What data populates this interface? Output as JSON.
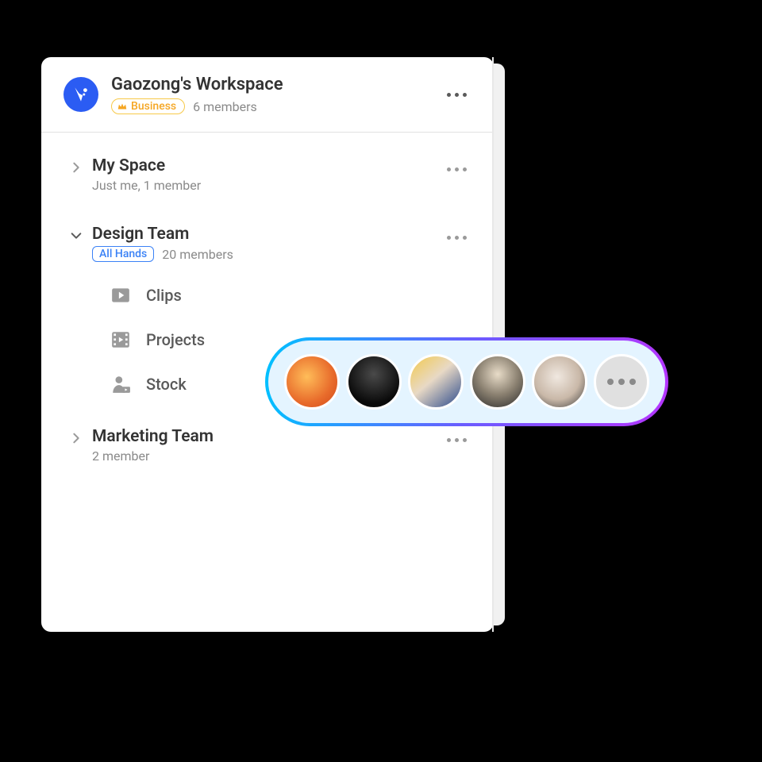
{
  "workspace": {
    "title": "Gaozong's Workspace",
    "plan_badge": "Business",
    "members_text": "6 members"
  },
  "sections": [
    {
      "title": "My Space",
      "subtitle": "Just me, 1 member",
      "expanded": false
    },
    {
      "title": "Design Team",
      "badge": "All Hands",
      "members_text": "20 members",
      "expanded": true,
      "items": [
        {
          "label": "Clips",
          "icon": "play-square-icon"
        },
        {
          "label": "Projects",
          "icon": "film-icon"
        },
        {
          "label": "Stock",
          "icon": "person-stock-icon"
        }
      ]
    },
    {
      "title": "Marketing Team",
      "subtitle": "2 member",
      "expanded": false
    }
  ],
  "avatar_overlay": {
    "avatar_count": 5,
    "has_more": true
  }
}
